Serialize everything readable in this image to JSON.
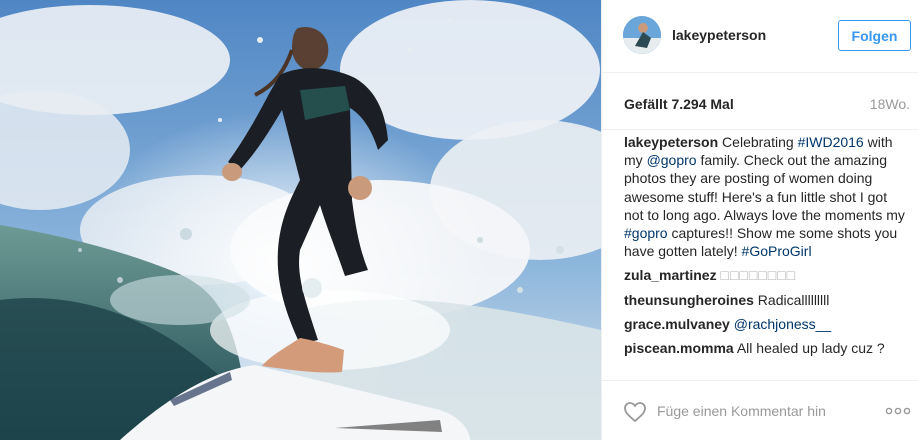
{
  "post": {
    "username": "lakeypeterson",
    "follow_label": "Folgen",
    "likes": "Gefällt 7.294 Mal",
    "age": "18Wo.",
    "caption": {
      "username": "lakeypeterson",
      "t1": " Celebrating ",
      "tag1": "#IWD2016",
      "t2": " with my ",
      "tag2": "@gopro",
      "t3": " family. Check out the amazing photos they are posting of women doing awesome stuff! Here's a fun little shot I got not to long ago. Always love the moments my ",
      "tag3": "#gopro",
      "t4": " captures!! Show me some shots you have gotten lately! ",
      "tag4": "#GoProGirl"
    },
    "comments": [
      {
        "username": "zula_martinez",
        "text": "□□□□□□□□"
      },
      {
        "username": "theunsungheroines",
        "text": "Radicalllllllll"
      },
      {
        "username": "grace.mulvaney",
        "mention": "@rachjoness__"
      },
      {
        "username": "piscean.momma",
        "text": "All healed up lady cuz ?"
      }
    ],
    "comment_placeholder": "Füge einen Kommentar hin"
  },
  "colors": {
    "accent": "#3897f0",
    "link": "#003569",
    "muted": "#999999",
    "border": "#efefef"
  },
  "icons": {
    "like": "heart-icon",
    "options": "ellipsis-icon"
  }
}
